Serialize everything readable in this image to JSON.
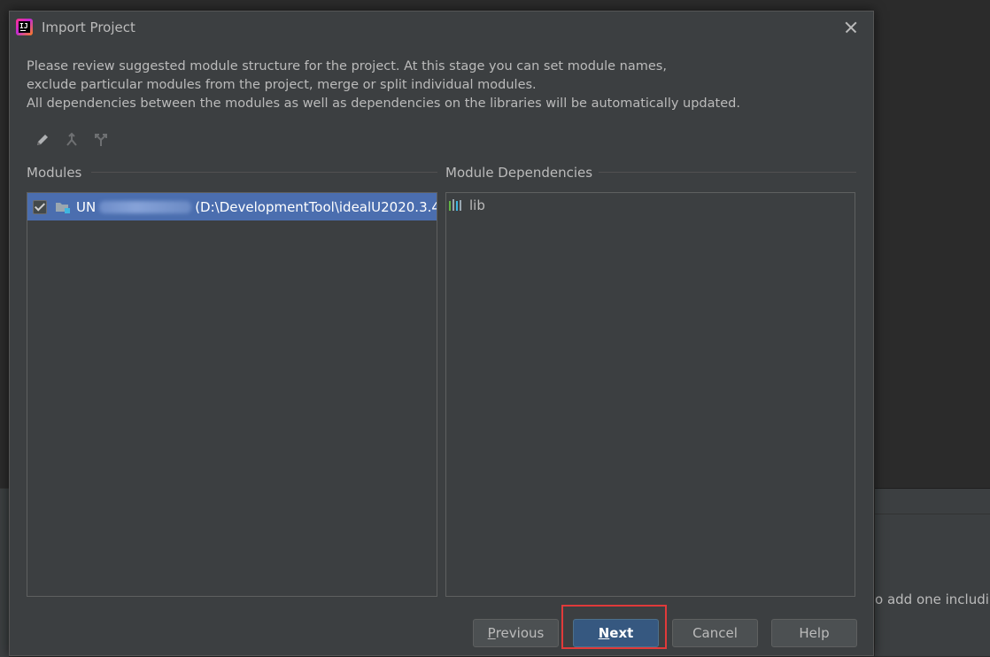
{
  "dialog": {
    "title": "Import Project",
    "description": [
      "Please review suggested module structure for the project. At this stage you can set module names,",
      "exclude particular modules from the project, merge or split individual modules.",
      "All dependencies between the modules as well as dependencies on the libraries will be automatically updated."
    ],
    "toolbar": [
      "edit-pencil-icon",
      "merge-icon",
      "split-icon"
    ]
  },
  "modules": {
    "label": "Modules",
    "items": [
      {
        "name_prefix": "UN",
        "path": "(D:\\DevelopmentTool\\idealU2020.3.4",
        "checked": true,
        "selected": true
      }
    ]
  },
  "dependencies": {
    "label": "Module Dependencies",
    "items": [
      {
        "name": "lib",
        "icon": "library-icon"
      }
    ]
  },
  "buttons": {
    "previous": {
      "mnemonic": "P",
      "rest": "revious"
    },
    "next": {
      "mnemonic": "N",
      "rest": "ext"
    },
    "cancel": "Cancel",
    "help": "Help"
  },
  "background": {
    "hint_text": "o add one includir"
  },
  "colors": {
    "dialog_bg": "#3c3f41",
    "selection": "#4b6eaf",
    "primary_button": "#365880",
    "highlight_box": "#e03a3a"
  }
}
